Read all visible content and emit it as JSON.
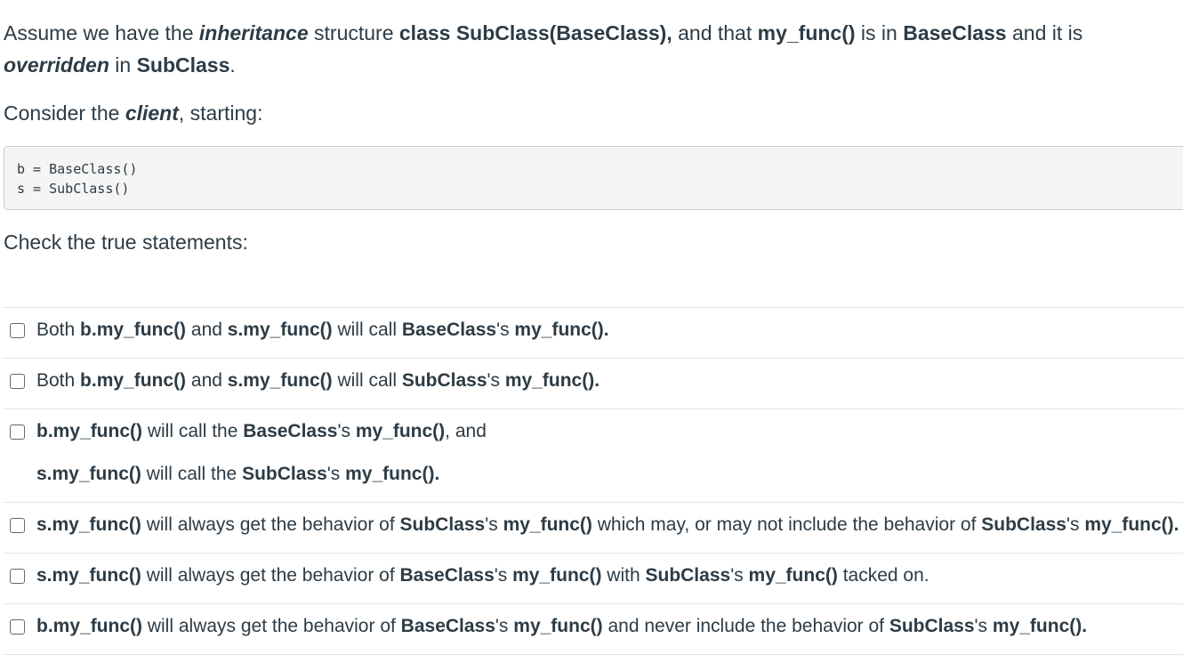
{
  "intro": {
    "t1": "Assume we have the ",
    "t2": "inheritance",
    "t3": " structure ",
    "t4": "class SubClass(BaseClass),",
    "t5": " and that ",
    "t6": "my_func()",
    "t7": " is in ",
    "t8": "BaseClass",
    "t9": " and it is ",
    "t10": "overridden",
    "t11": " in ",
    "t12": "SubClass",
    "t13": "."
  },
  "client": {
    "t1": "Consider the ",
    "t2": "client",
    "t3": ", starting:"
  },
  "code": {
    "line1": "b = BaseClass()",
    "line2": "s = SubClass()"
  },
  "check_prompt": "Check the true statements:",
  "answers": [
    {
      "parts": [
        "Both ",
        "b.my_func()",
        " and ",
        "s.my_func()",
        " will call ",
        "BaseClass",
        "'s ",
        "my_func().",
        ""
      ]
    },
    {
      "parts": [
        "Both ",
        "b.my_func()",
        " and ",
        "s.my_func()",
        " will call ",
        "SubClass",
        "'s ",
        "my_func().",
        ""
      ]
    },
    {
      "line1": [
        "b.my_func()",
        " will call the ",
        "BaseClass",
        "'s ",
        "my_func()",
        ", and"
      ],
      "line2": [
        "s.my_func()",
        " will call the ",
        "SubClass",
        "'s ",
        "my_func()."
      ]
    },
    {
      "parts": [
        "s.my_func()",
        " will always get the behavior of  ",
        "SubClass",
        "'s ",
        "my_func()",
        " which may, or may not include the behavior of ",
        "SubClass",
        "'s ",
        "my_func()."
      ]
    },
    {
      "parts": [
        "s.my_func()",
        " will always get the behavior of  ",
        "BaseClass",
        "'s ",
        "my_func()",
        " with ",
        "SubClass",
        "'s ",
        "my_func()",
        " tacked on."
      ]
    },
    {
      "parts": [
        "b.my_func()",
        " will always get the behavior of  ",
        "BaseClass",
        "'s ",
        "my_func()",
        " and never include the behavior of ",
        "SubClass",
        "'s ",
        "my_func()."
      ]
    }
  ]
}
